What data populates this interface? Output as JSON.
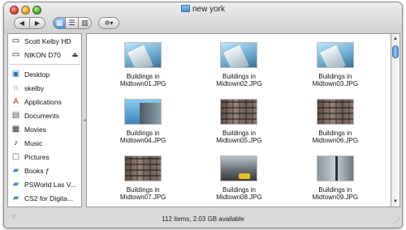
{
  "window": {
    "title": "new york"
  },
  "toolbar": {
    "back_glyph": "◀",
    "forward_glyph": "▶",
    "view_icons": [
      "icon-view-icon",
      "list-view-icon",
      "column-view-icon"
    ],
    "action_glyph": "✲▾"
  },
  "sidebar": {
    "devices": [
      {
        "label": "Scott Kelby HD",
        "icon": "hard-drive-icon",
        "eject": false
      },
      {
        "label": "NIKON D70",
        "icon": "camera-card-icon",
        "eject": true
      }
    ],
    "places": [
      {
        "label": "Desktop",
        "icon": "desktop-icon"
      },
      {
        "label": "skelby",
        "icon": "home-icon"
      },
      {
        "label": "Applications",
        "icon": "applications-icon"
      },
      {
        "label": "Documents",
        "icon": "documents-icon"
      },
      {
        "label": "Movies",
        "icon": "movies-icon"
      },
      {
        "label": "Music",
        "icon": "music-icon"
      },
      {
        "label": "Pictures",
        "icon": "pictures-icon"
      },
      {
        "label": "Books ƒ",
        "icon": "folder-icon"
      },
      {
        "label": "PSWorld Las V...",
        "icon": "folder-icon"
      },
      {
        "label": "CS2 for Digita...",
        "icon": "folder-icon"
      }
    ]
  },
  "files": [
    {
      "line1": "Buildings in",
      "line2": "Midtown01.JPG",
      "thumb": "sky"
    },
    {
      "line1": "Buildings in",
      "line2": "Midtown02.JPG",
      "thumb": "sky"
    },
    {
      "line1": "Buildings in",
      "line2": "Midtown03.JPG",
      "thumb": "sky"
    },
    {
      "line1": "Buildings in",
      "line2": "Midtown04.JPG",
      "thumb": "tower"
    },
    {
      "line1": "Buildings in",
      "line2": "Midtown05.JPG",
      "thumb": "brick"
    },
    {
      "line1": "Buildings in",
      "line2": "Midtown06.JPG",
      "thumb": "brick"
    },
    {
      "line1": "Buildings in",
      "line2": "Midtown07.JPG",
      "thumb": "brick"
    },
    {
      "line1": "Buildings in",
      "line2": "Midtown08.JPG",
      "thumb": "street"
    },
    {
      "line1": "Buildings in",
      "line2": "Midtown09.JPG",
      "thumb": "lamp"
    }
  ],
  "status": {
    "text": "112 items, 2.03 GB available"
  },
  "colors": {
    "selection_blue": "#4f8fd5",
    "close": "#d6342b",
    "minimize": "#d99b1c",
    "zoom": "#3f9b2a"
  }
}
